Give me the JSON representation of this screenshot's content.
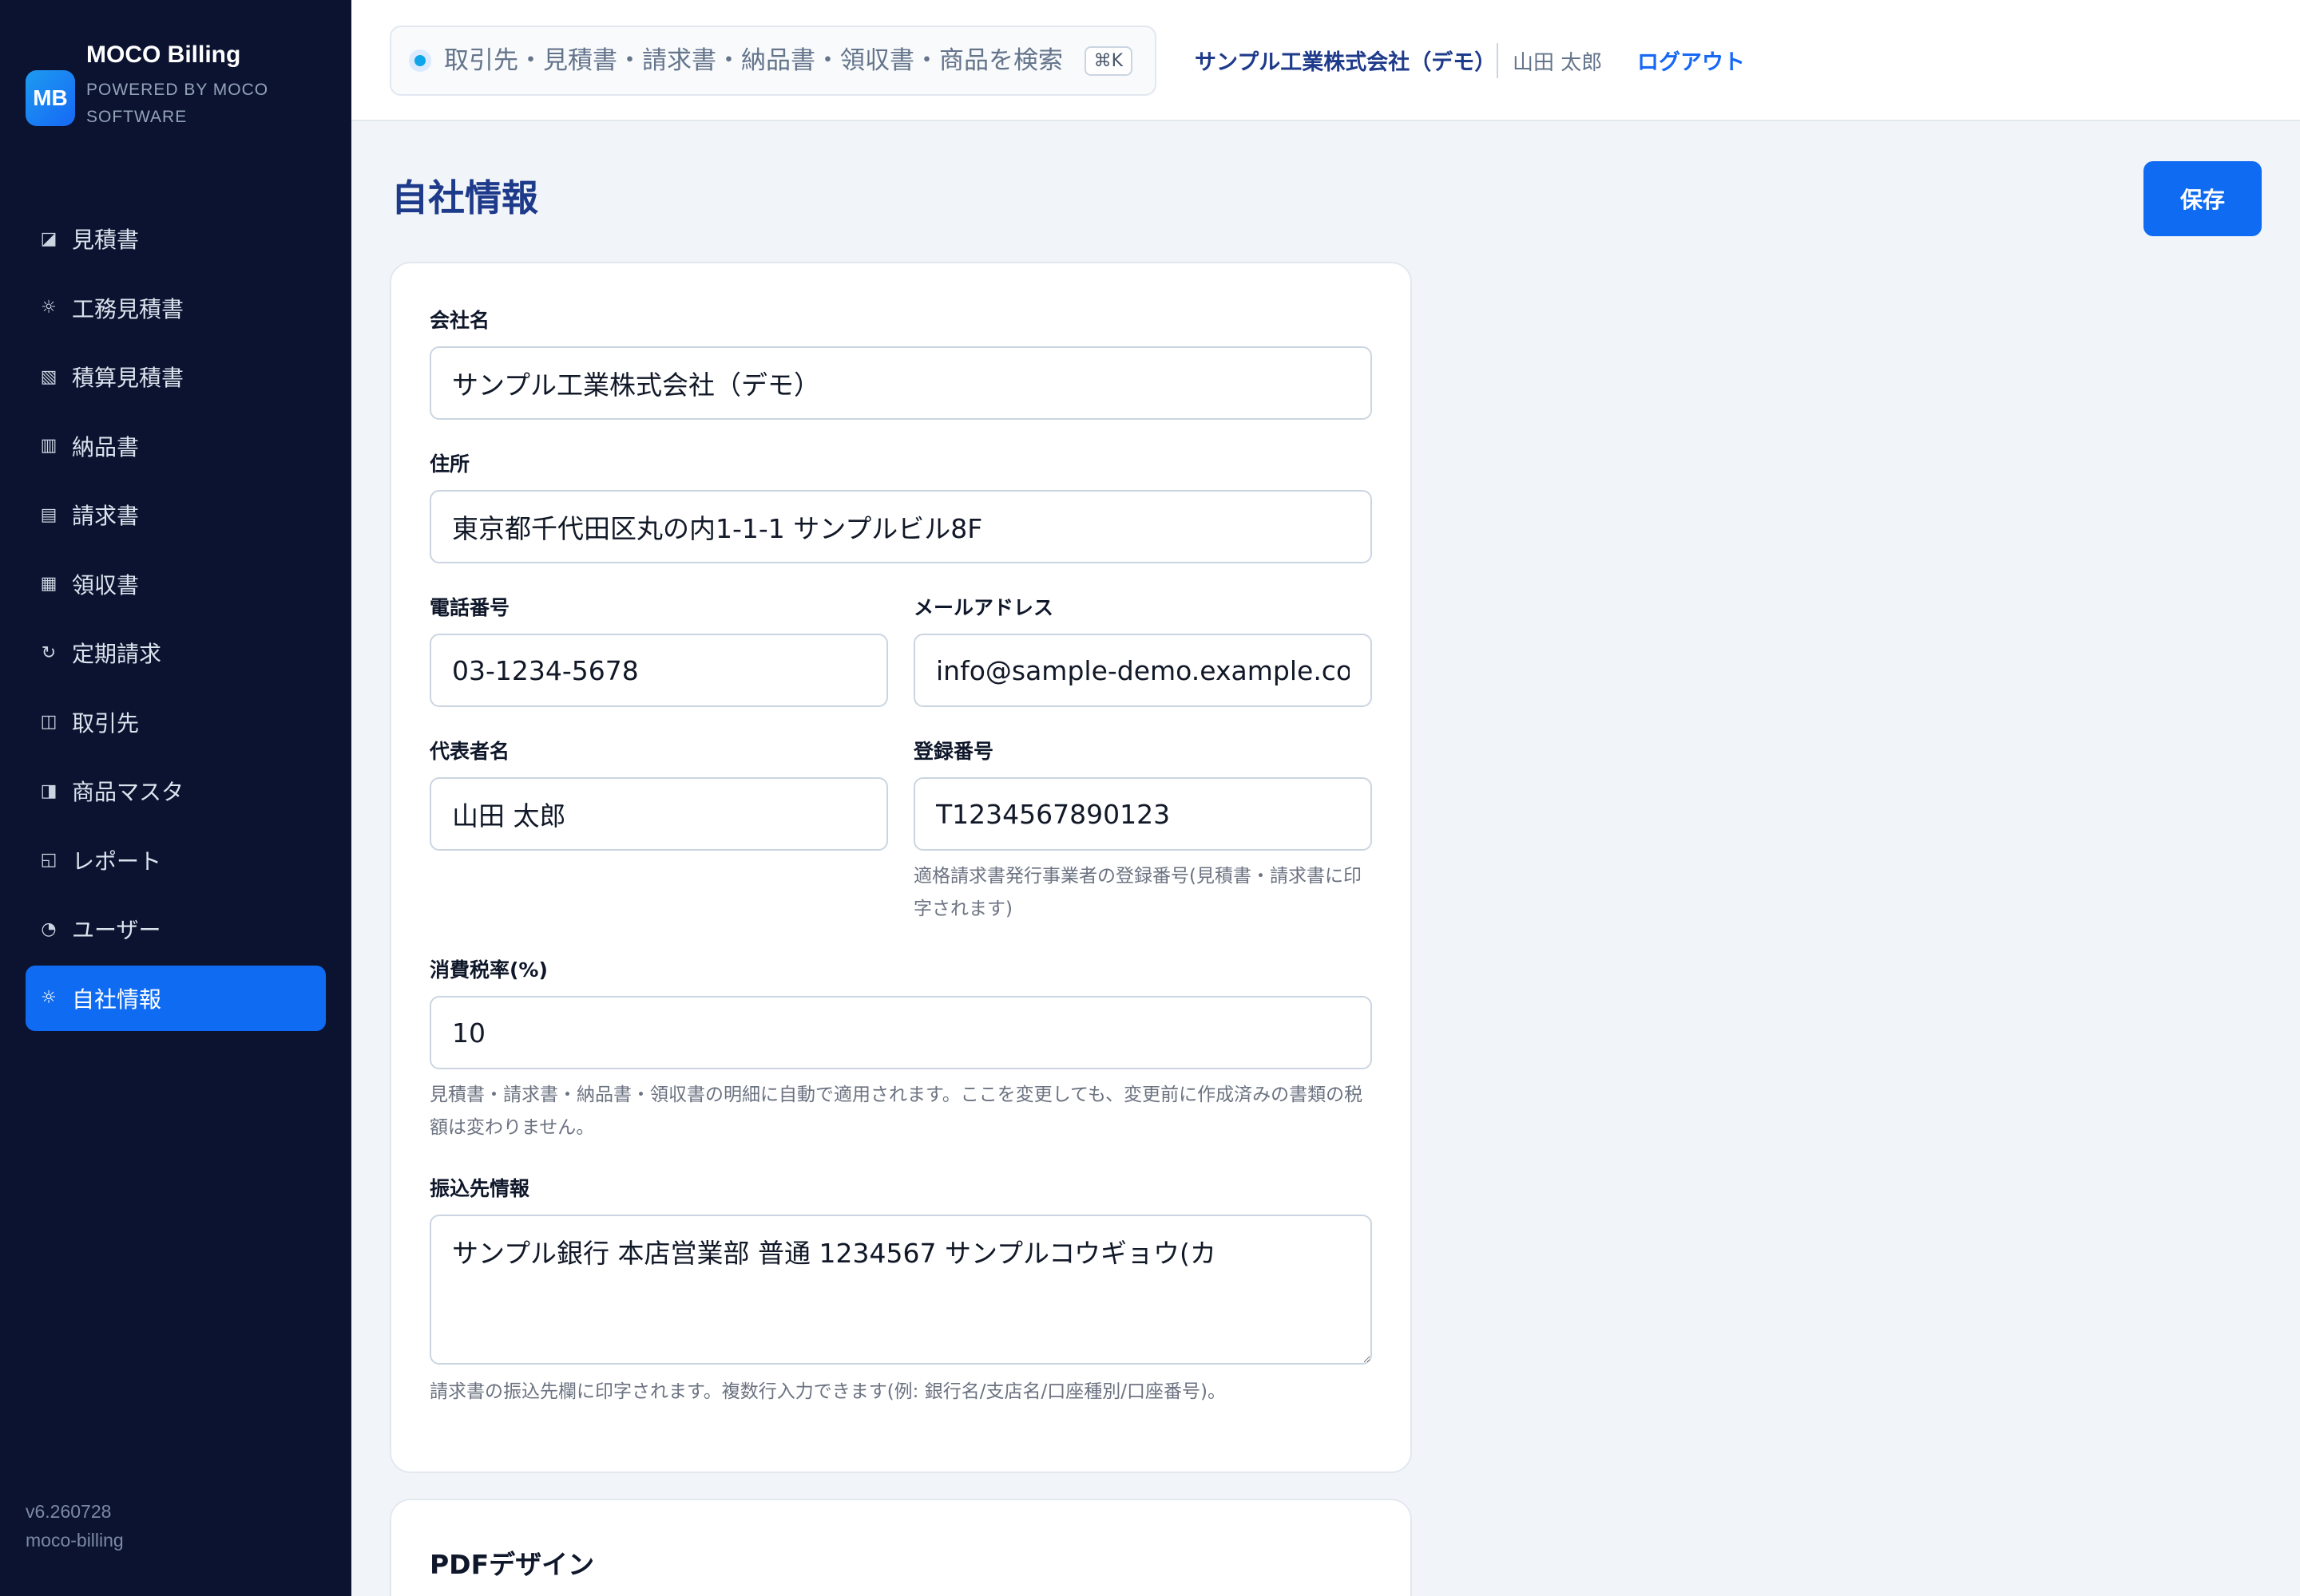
{
  "brand": {
    "logo": "MB",
    "name": "MOCO Billing",
    "sub": "POWERED BY MOCO SOFTWARE"
  },
  "nav": [
    {
      "label": "見積書",
      "icon": "◪"
    },
    {
      "label": "工務見積書",
      "icon": "☼"
    },
    {
      "label": "積算見積書",
      "icon": "▧"
    },
    {
      "label": "納品書",
      "icon": "▥"
    },
    {
      "label": "請求書",
      "icon": "▤"
    },
    {
      "label": "領収書",
      "icon": "▦"
    },
    {
      "label": "定期請求",
      "icon": "↻"
    },
    {
      "label": "取引先",
      "icon": "◫"
    },
    {
      "label": "商品マスタ",
      "icon": "◨"
    },
    {
      "label": "レポート",
      "icon": "◱"
    },
    {
      "label": "ユーザー",
      "icon": "◔"
    },
    {
      "label": "自社情報",
      "icon": "☼"
    }
  ],
  "active_nav": "自社情報",
  "footer": {
    "version": "v6.260728",
    "app_id": "moco-billing"
  },
  "topbar": {
    "search_placeholder": "取引先・見積書・請求書・納品書・領収書・商品を検索",
    "shortcut": "⌘K",
    "company": "サンプル工業株式会社（デモ）",
    "user": "山田 太郎",
    "logout": "ログアウト"
  },
  "page": {
    "title": "自社情報",
    "save_label": "保存"
  },
  "form": {
    "company_name": {
      "label": "会社名",
      "value": "サンプル工業株式会社（デモ）"
    },
    "address": {
      "label": "住所",
      "value": "東京都千代田区丸の内1-1-1 サンプルビル8F"
    },
    "phone": {
      "label": "電話番号",
      "value": "03-1234-5678"
    },
    "email": {
      "label": "メールアドレス",
      "value": "info@sample-demo.example.com"
    },
    "representative": {
      "label": "代表者名",
      "value": "山田 太郎"
    },
    "registration": {
      "label": "登録番号",
      "value": "T1234567890123",
      "help": "適格請求書発行事業者の登録番号(見積書・請求書に印字されます)"
    },
    "tax_rate": {
      "label": "消費税率(%)",
      "value": "10",
      "help": "見積書・請求書・納品書・領収書の明細に自動で適用されます。ここを変更しても、変更前に作成済みの書類の税額は変わりません。"
    },
    "bank": {
      "label": "振込先情報",
      "value": "サンプル銀行 本店営業部 普通 1234567 サンプルコウギョウ(カ",
      "help": "請求書の振込先欄に印字されます。複数行入力できます(例: 銀行名/支店名/口座種別/口座番号)。"
    }
  },
  "pdf_section": {
    "title": "PDFデザイン"
  }
}
